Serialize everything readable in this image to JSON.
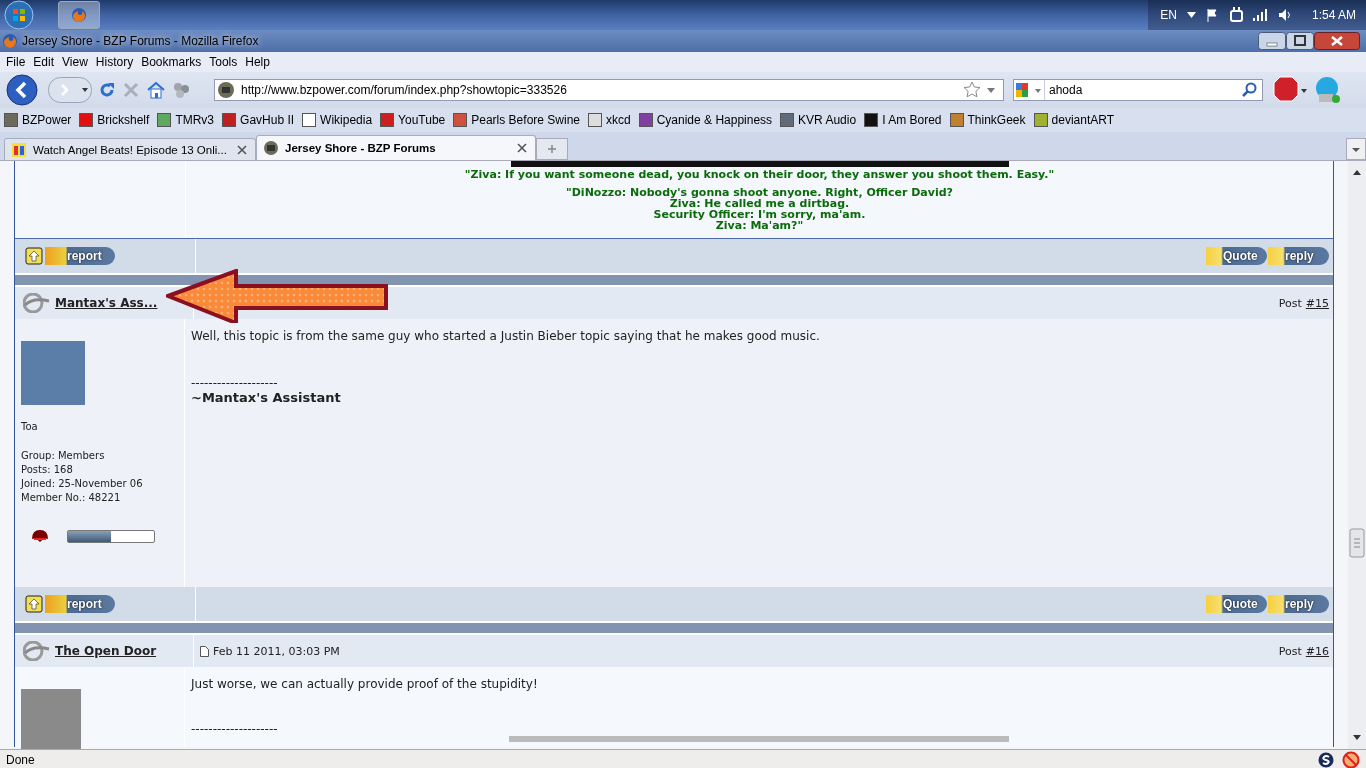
{
  "taskbar": {
    "language": "EN",
    "clock": "1:54 AM"
  },
  "window": {
    "title": "Jersey Shore - BZP Forums - Mozilla Firefox"
  },
  "menu": [
    "File",
    "Edit",
    "View",
    "History",
    "Bookmarks",
    "Tools",
    "Help"
  ],
  "address_bar": {
    "value": "http://www.bzpower.com/forum/index.php?showtopic=333526"
  },
  "search": {
    "value": "ahoda"
  },
  "bookmarks": [
    {
      "label": "BZPower",
      "color": "#6b6b5a"
    },
    {
      "label": "Brickshelf",
      "color": "#e01010"
    },
    {
      "label": "TMRv3",
      "color": "#5fa85f"
    },
    {
      "label": "GavHub II",
      "color": "#c02020"
    },
    {
      "label": "Wikipedia",
      "color": "#ffffff"
    },
    {
      "label": "YouTube",
      "color": "#cc2020"
    },
    {
      "label": "Pearls Before Swine",
      "color": "#d05040"
    },
    {
      "label": "xkcd",
      "color": "#dddddd"
    },
    {
      "label": "Cyanide & Happiness",
      "color": "#8040a0"
    },
    {
      "label": "KVR Audio",
      "color": "#606a78"
    },
    {
      "label": "I Am Bored",
      "color": "#111111"
    },
    {
      "label": "ThinkGeek",
      "color": "#c08030"
    },
    {
      "label": "deviantART",
      "color": "#a0b030"
    }
  ],
  "tabs": [
    {
      "title": "Watch Angel Beats! Episode 13 Onli...",
      "selected": false
    },
    {
      "title": "Jersey Shore - BZP Forums",
      "selected": true
    }
  ],
  "quote": [
    [
      "\"Ziva: If you want someone dead, you knock on their door, they answer you shoot them. Easy.\""
    ],
    [
      "\"DiNozzo: Nobody's gonna shoot anyone. Right, Officer David?",
      "Ziva: He called me a dirtbag.",
      "Security Officer: I'm sorry, ma'am.",
      "Ziva: Ma'am?\""
    ]
  ],
  "post_buttons": [
    {
      "report": "report",
      "quote": "Quote",
      "reply": "reply"
    },
    {
      "report": "report",
      "quote": "Quote",
      "reply": "reply"
    }
  ],
  "posts": [
    {
      "author": "Mantax's Ass...",
      "post_label": "Post",
      "post_number": "#15",
      "body": "Well, this topic is from the same guy who started a Justin Bieber topic saying that he makes good music.",
      "signature_rule": "--------------------",
      "signature": "~Mantax's Assistant",
      "profile": {
        "title": "Toa",
        "stats": [
          "Group: Members",
          "Posts: 168",
          "Joined: 25-November 06",
          "Member No.: 48221"
        ],
        "level": 0.5
      },
      "annotated": true
    },
    {
      "author": "The Open Door",
      "date": "Feb 11 2011, 03:03 PM",
      "post_label": "Post",
      "post_number": "#16",
      "body": "Just worse, we can actually provide proof of the stupidity!",
      "signature_rule": "--------------------",
      "annotated": false
    }
  ],
  "status_bar": {
    "text": "Done"
  }
}
